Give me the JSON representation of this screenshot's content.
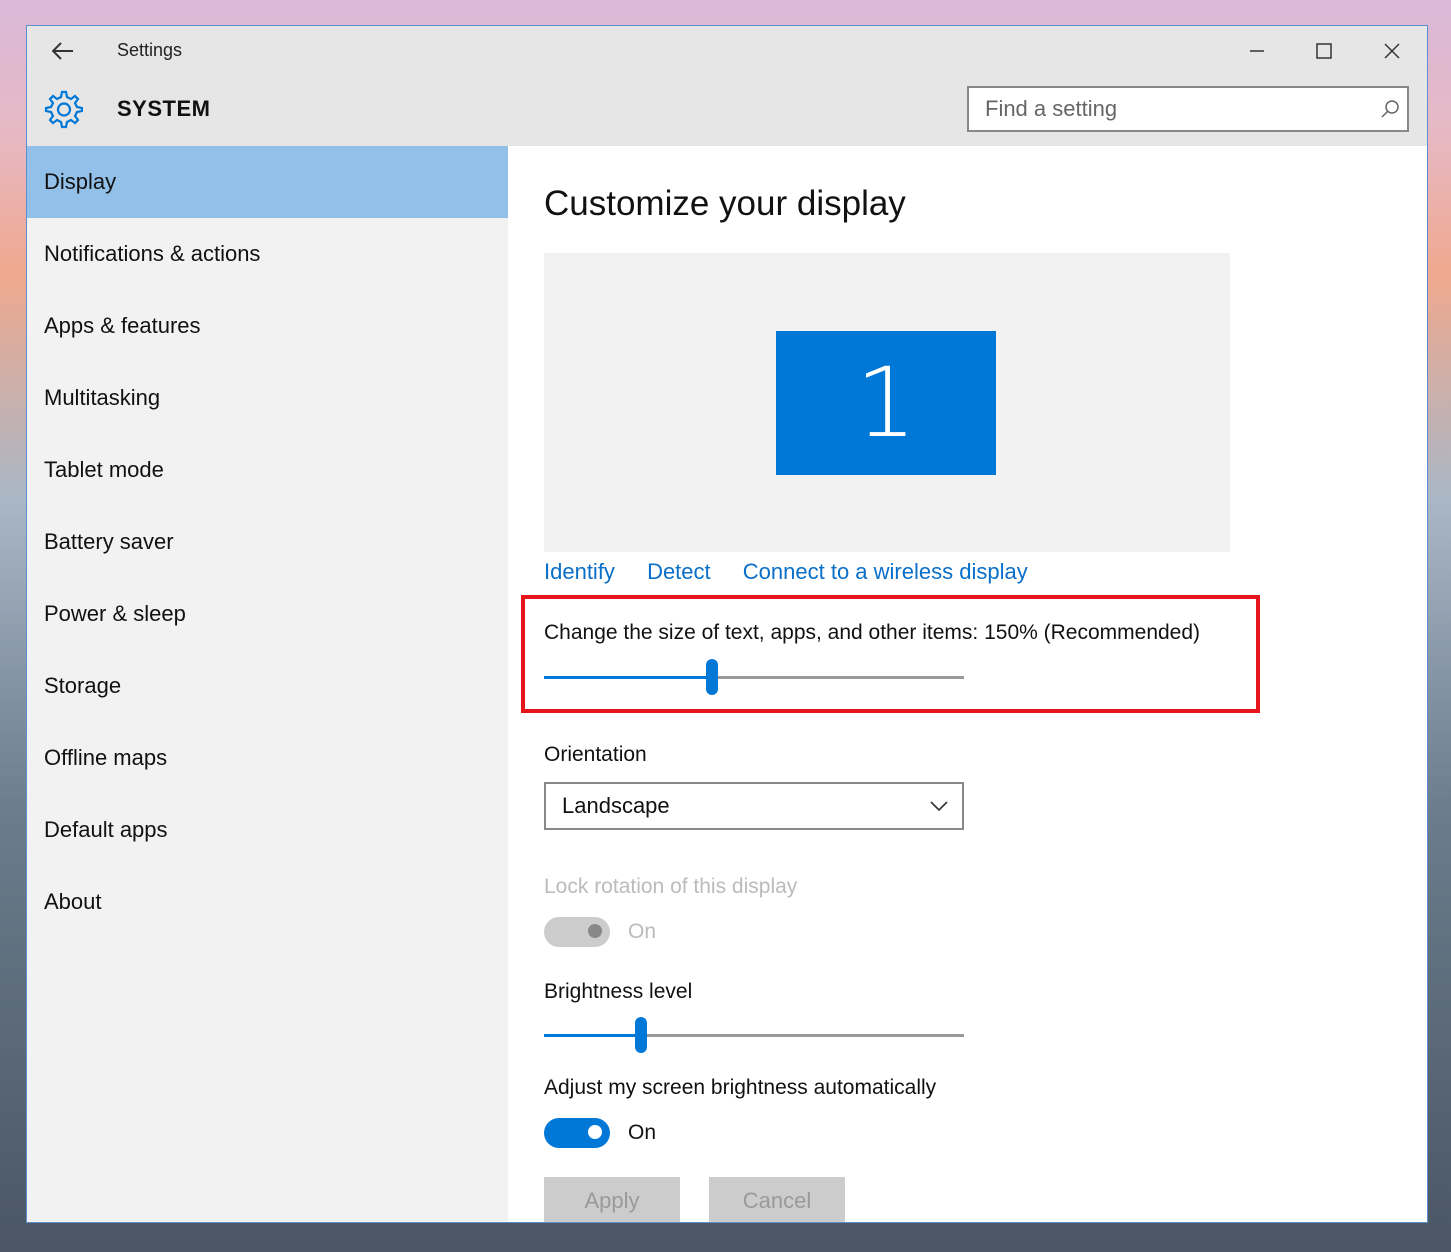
{
  "window": {
    "title": "Settings",
    "controls": [
      "minimize-icon",
      "maximize-icon",
      "close-icon"
    ]
  },
  "header": {
    "title": "SYSTEM",
    "icon": "gear-icon",
    "search_placeholder": "Find a setting"
  },
  "sidebar": {
    "items": [
      {
        "label": "Display",
        "selected": true
      },
      {
        "label": "Notifications & actions"
      },
      {
        "label": "Apps & features"
      },
      {
        "label": "Multitasking"
      },
      {
        "label": "Tablet mode"
      },
      {
        "label": "Battery saver"
      },
      {
        "label": "Power & sleep"
      },
      {
        "label": "Storage"
      },
      {
        "label": "Offline maps"
      },
      {
        "label": "Default apps"
      },
      {
        "label": "About"
      }
    ]
  },
  "main": {
    "title": "Customize your display",
    "monitor_number": "1",
    "links": {
      "identify": "Identify",
      "detect": "Detect",
      "connect": "Connect to a wireless display"
    },
    "scale": {
      "label": "Change the size of text, apps, and other items: 150% (Recommended)",
      "level": 0.4
    },
    "orientation": {
      "label": "Orientation",
      "value": "Landscape"
    },
    "lock_rotation": {
      "label": "Lock rotation of this display",
      "state": "On",
      "disabled": true
    },
    "brightness": {
      "label": "Brightness level",
      "level": 0.23
    },
    "auto_brightness": {
      "label": "Adjust my screen brightness automatically",
      "state": "On"
    },
    "buttons": {
      "apply": "Apply",
      "cancel": "Cancel"
    }
  },
  "colors": {
    "accent": "#0078d7",
    "link": "#0a6fc8",
    "selected_nav": "#92c0e8",
    "highlight_box": "#e8141c"
  }
}
